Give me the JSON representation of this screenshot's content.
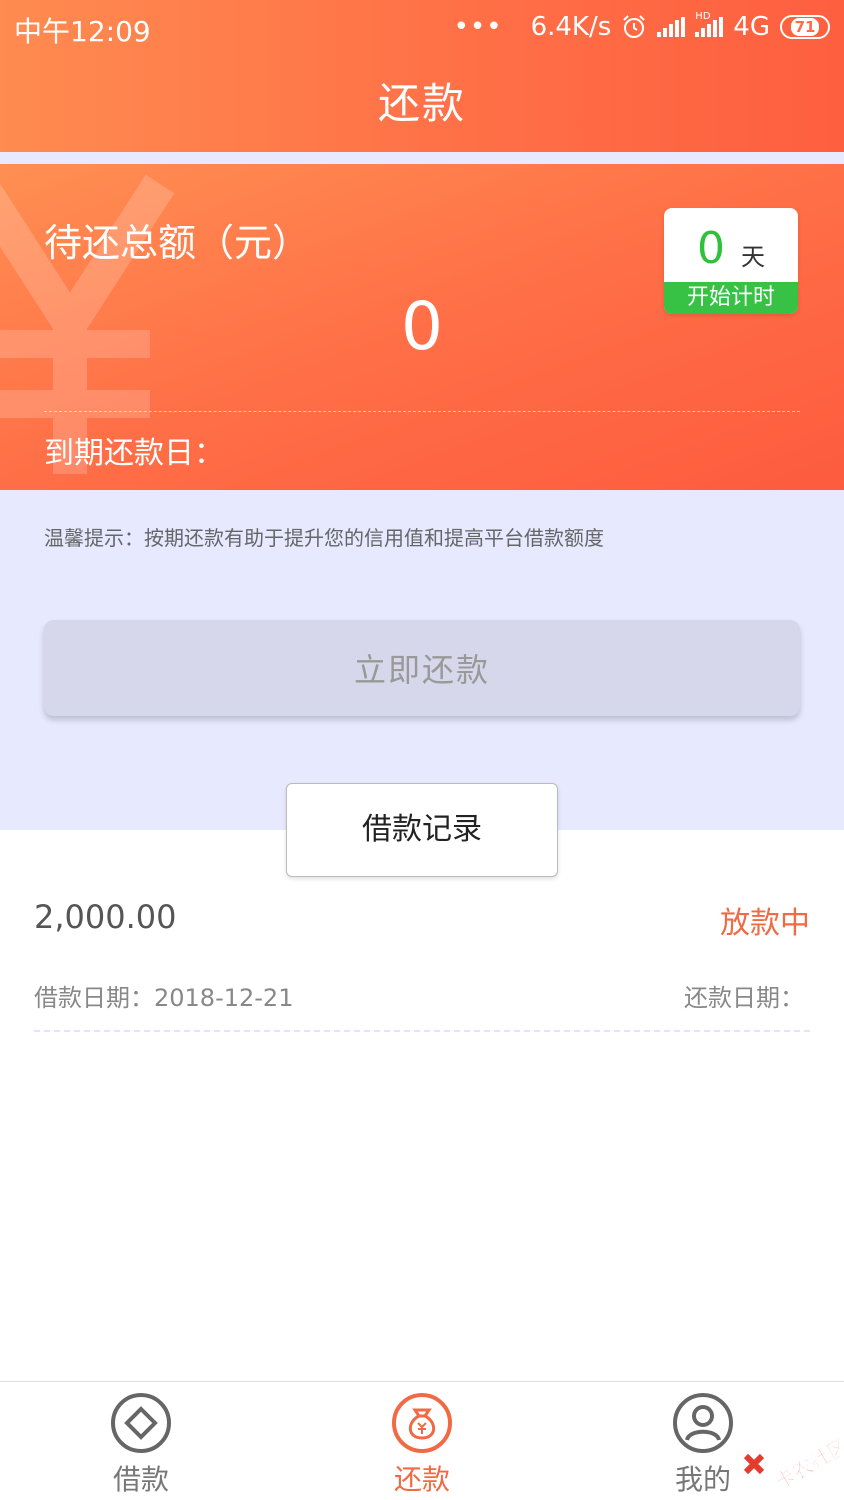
{
  "status_bar": {
    "time": "中午12:09",
    "dots": "•••",
    "net_speed": "6.4K/s",
    "hd": "HD",
    "network": "4G",
    "battery": "71"
  },
  "header": {
    "title": "还款"
  },
  "amount_card": {
    "label": "待还总额（元）",
    "amount": "0",
    "days_value": "0",
    "days_unit": "天",
    "days_caption": "开始计时",
    "due_label": "到期还款日："
  },
  "tip": {
    "text": "温馨提示：按期还款有助于提升您的信用值和提高平台借款额度"
  },
  "repay_button": {
    "label": "立即还款"
  },
  "records": {
    "tab_label": "借款记录",
    "items": [
      {
        "amount": "2,000.00",
        "status": "放款中",
        "loan_date": "借款日期：2018-12-21",
        "repay_date": "还款日期："
      }
    ]
  },
  "bottom_nav": {
    "items": [
      {
        "label": "借款",
        "icon": "diamond-circle-icon"
      },
      {
        "label": "还款",
        "icon": "money-bag-icon",
        "active": true
      },
      {
        "label": "我的",
        "icon": "user-icon"
      }
    ]
  },
  "watermark": {
    "text": "卡农社区"
  },
  "colors": {
    "accent": "#f06a43",
    "header_orange": "#ff7047",
    "timer_green": "#37c246",
    "page_bg": "#e6e9ff"
  }
}
